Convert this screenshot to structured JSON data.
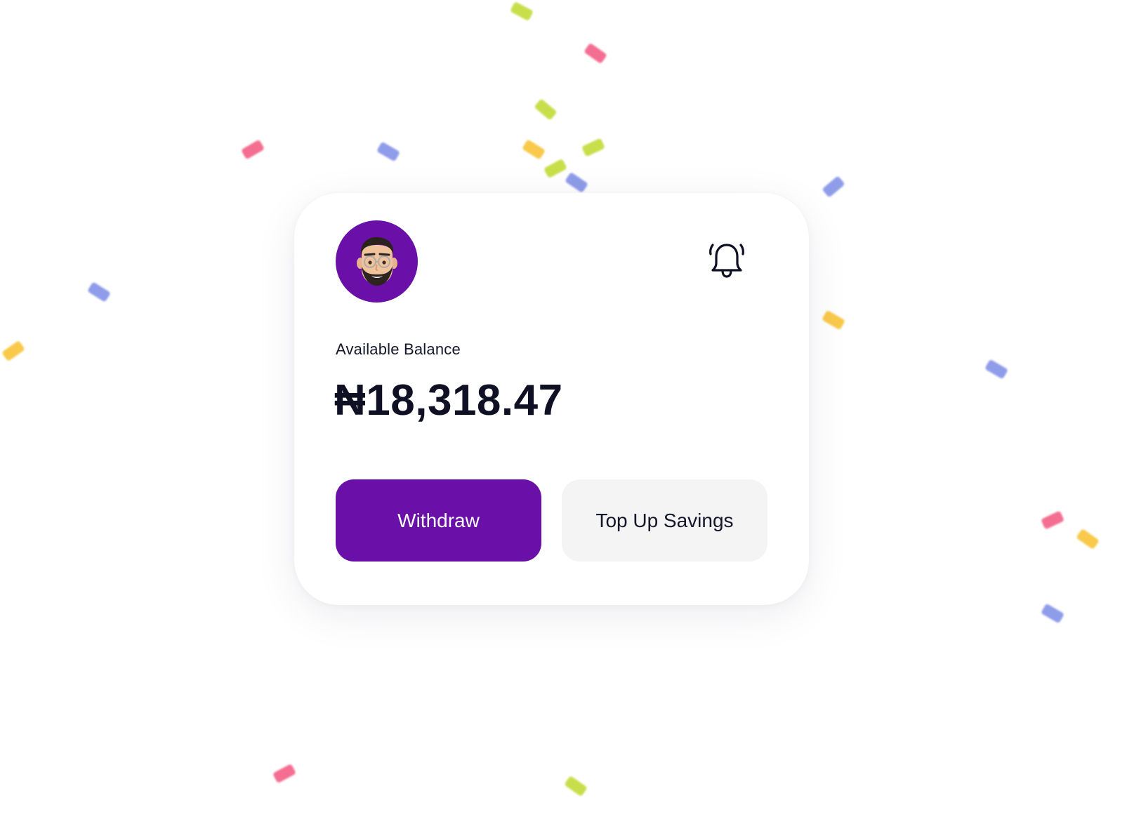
{
  "avatar": {
    "icon": "memoji-avatar-icon",
    "background": "#6a0fa8"
  },
  "notifications": {
    "icon": "bell-icon"
  },
  "balance": {
    "label": "Available Balance",
    "amount": "₦18,318.47"
  },
  "actions": {
    "withdraw_label": "Withdraw",
    "topup_label": "Top Up Savings"
  },
  "colors": {
    "brand": "#6a0fa8",
    "secondary_button": "#f4f4f5",
    "text": "#0f1024",
    "confetti": [
      "#f2557e",
      "#7b8be6",
      "#c0d92c",
      "#f7c02b"
    ]
  }
}
